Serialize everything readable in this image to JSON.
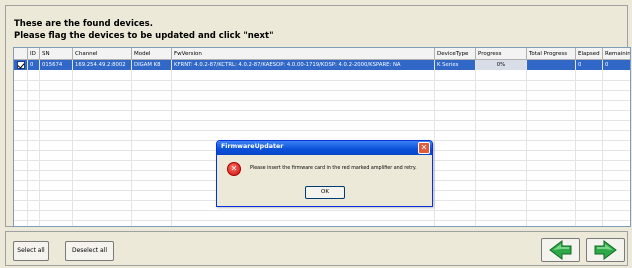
{
  "instructions": {
    "line1": "These are the found devices.",
    "line2": "Please flag the devices to be updated and click \"next\""
  },
  "table": {
    "columns": [
      "ID",
      "SN",
      "Channel",
      "Model",
      "FwVersion",
      "DeviceType",
      "Progress",
      "Total Progress",
      "Elapsed",
      "Remaining"
    ],
    "rows": [
      {
        "checked": true,
        "id": "0",
        "sn": "015674",
        "channel": "169.254.49.2:8002",
        "model": "DIGAM K8",
        "fw": "KFRNT: 4.0.2-87/KCTRL: 4.0.2-87/KAESOP: 4.0.00-1719/KDSP: 4.0.2-2000/KSPARE: NA",
        "device_type": "K Series",
        "progress": "0%",
        "total_progress": "",
        "elapsed": "0",
        "remaining": "0"
      }
    ]
  },
  "buttons": {
    "select_all": "Select all",
    "deselect_all": "Deselect all",
    "back_icon": "green-left-arrow-icon",
    "next_icon": "green-right-arrow-icon"
  },
  "dialog": {
    "title": "FirmwareUpdater",
    "message": "Please insert the firmware card in the red marked amplifier and retry.",
    "ok": "OK",
    "icon": "error-icon"
  },
  "colors": {
    "selection": "#3168c8",
    "titlebar": "#0a50d6",
    "nav_arrow": "#2fa84a"
  }
}
